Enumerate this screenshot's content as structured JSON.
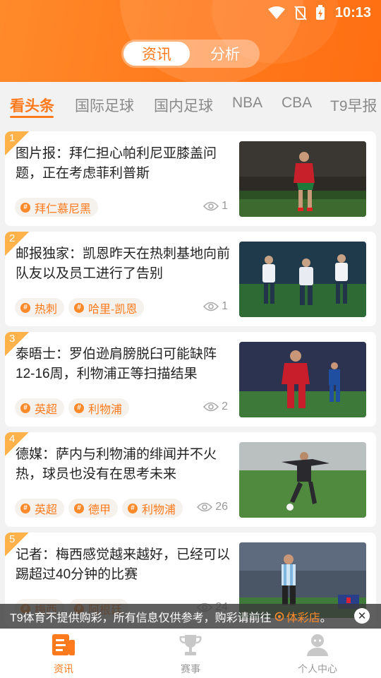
{
  "status_bar": {
    "time": "10:13"
  },
  "segment": {
    "active": "资讯",
    "inactive": "分析"
  },
  "tabs": [
    {
      "label": "看头条",
      "active": true
    },
    {
      "label": "国际足球",
      "active": false
    },
    {
      "label": "国内足球",
      "active": false
    },
    {
      "label": "NBA",
      "active": false
    },
    {
      "label": "CBA",
      "active": false
    },
    {
      "label": "T9早报",
      "active": false
    }
  ],
  "articles": [
    {
      "rank": "1",
      "title": "图片报：拜仁担心帕利尼亚膝盖问题，正在考虑菲利普斯",
      "tags": [
        "拜仁慕尼黑"
      ],
      "views": "1"
    },
    {
      "rank": "2",
      "title": "邮报独家：凯恩昨天在热刺基地向前队友以及员工进行了告别",
      "tags": [
        "热刺",
        "哈里-凯恩"
      ],
      "views": "1"
    },
    {
      "rank": "3",
      "title": "泰晤士：罗伯逊肩膀脱臼可能缺阵12-16周，利物浦正等扫描结果",
      "tags": [
        "英超",
        "利物浦"
      ],
      "views": "2"
    },
    {
      "rank": "4",
      "title": "德媒：萨内与利物浦的绯闻并不火热，球员也没有在思考未来",
      "tags": [
        "英超",
        "德甲",
        "利物浦"
      ],
      "views": "26"
    },
    {
      "rank": "5",
      "title": "记者：梅西感觉越来越好，已经可以踢超过40分钟的比赛",
      "tags": [
        "梅西",
        "阿根廷"
      ],
      "views": "24"
    }
  ],
  "notice": {
    "text": "T9体育不提供购彩，所有信息仅供参考，购彩请前往",
    "link": "体彩店",
    "end": "。"
  },
  "bottom_nav": [
    {
      "label": "资讯",
      "icon": "news-icon",
      "active": true
    },
    {
      "label": "赛事",
      "icon": "trophy-icon",
      "active": false
    },
    {
      "label": "个人中心",
      "icon": "user-icon",
      "active": false
    }
  ],
  "colors": {
    "accent": "#ff7a1c",
    "background": "#f2f2f2"
  }
}
